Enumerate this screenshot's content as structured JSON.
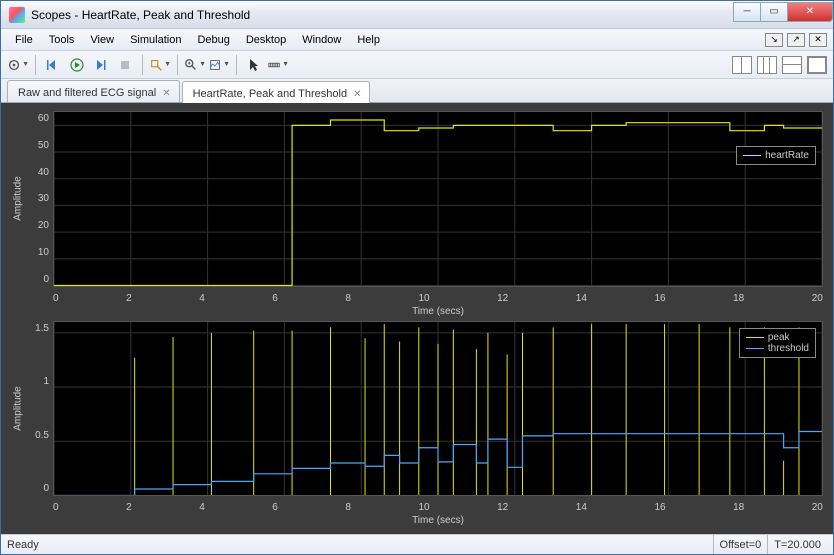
{
  "window": {
    "title": "Scopes - HeartRate, Peak and Threshold"
  },
  "menu": {
    "file": "File",
    "tools": "Tools",
    "view": "View",
    "simulation": "Simulation",
    "debug": "Debug",
    "desktop": "Desktop",
    "window": "Window",
    "help": "Help"
  },
  "tabs": [
    {
      "label": "Raw and filtered ECG signal",
      "active": false
    },
    {
      "label": "HeartRate, Peak and Threshold",
      "active": true
    }
  ],
  "status": {
    "ready": "Ready",
    "offset": "Offset=0",
    "time": "T=20.000"
  },
  "axis": {
    "ylabel": "Amplitude",
    "xlabel": "Time (secs)"
  },
  "legend1": {
    "heartRate": "heartRate"
  },
  "legend2": {
    "peak": "peak",
    "threshold": "threshold"
  },
  "chart_data": [
    {
      "type": "line",
      "title": "",
      "xlabel": "Time (secs)",
      "ylabel": "Amplitude",
      "xlim": [
        0,
        20
      ],
      "ylim": [
        0,
        65
      ],
      "xticks": [
        0,
        2,
        4,
        6,
        8,
        10,
        12,
        14,
        16,
        18,
        20
      ],
      "yticks": [
        0,
        10,
        20,
        30,
        40,
        50,
        60
      ],
      "series": [
        {
          "name": "heartRate",
          "color": "#e6e600",
          "x": [
            0,
            6.2,
            6.2,
            7.2,
            7.2,
            8.6,
            8.6,
            9.5,
            9.5,
            10.4,
            10.4,
            13.0,
            13.0,
            14.0,
            14.0,
            14.9,
            14.9,
            17.6,
            17.6,
            18.5,
            18.5,
            19.0,
            19.0,
            20.0
          ],
          "y": [
            0,
            0,
            60,
            60,
            62,
            62,
            58,
            58,
            59,
            59,
            60,
            60,
            58,
            58,
            60,
            60,
            61,
            61,
            58,
            58,
            60,
            60,
            59,
            59
          ]
        }
      ]
    },
    {
      "type": "line",
      "title": "",
      "xlabel": "Time (secs)",
      "ylabel": "Amplitude",
      "xlim": [
        0,
        20
      ],
      "ylim": [
        0,
        1.6
      ],
      "xticks": [
        0,
        2,
        4,
        6,
        8,
        10,
        12,
        14,
        16,
        18,
        20
      ],
      "yticks": [
        0,
        0.5,
        1,
        1.5
      ],
      "series": [
        {
          "name": "peak",
          "color": "#e6e600",
          "spikes_x": [
            2.1,
            3.1,
            4.1,
            5.2,
            6.2,
            7.2,
            8.1,
            8.6,
            9.0,
            9.5,
            10.0,
            10.4,
            11.0,
            11.3,
            11.8,
            12.2,
            13.0,
            14.0,
            14.9,
            15.9,
            16.8,
            17.6,
            18.5,
            19.0,
            19.4
          ],
          "spikes_y": [
            1.27,
            1.46,
            1.5,
            1.52,
            1.52,
            1.55,
            1.45,
            1.58,
            1.42,
            1.55,
            1.4,
            1.53,
            1.35,
            1.5,
            1.3,
            1.5,
            1.55,
            1.58,
            1.58,
            1.58,
            1.58,
            1.55,
            1.55,
            0.32,
            1.55
          ]
        },
        {
          "name": "threshold",
          "color": "#4aa8ff",
          "x": [
            0,
            2.1,
            2.1,
            3.1,
            3.1,
            4.1,
            4.1,
            5.2,
            5.2,
            6.2,
            6.2,
            7.2,
            7.2,
            8.1,
            8.1,
            8.6,
            8.6,
            9.0,
            9.0,
            9.5,
            9.5,
            10.0,
            10.0,
            10.4,
            10.4,
            11.0,
            11.0,
            11.3,
            11.3,
            11.8,
            11.8,
            12.2,
            12.2,
            13.0,
            13.0,
            19.0,
            19.0,
            19.4,
            19.4,
            20.0
          ],
          "y": [
            0,
            0,
            0.06,
            0.06,
            0.1,
            0.1,
            0.13,
            0.13,
            0.2,
            0.2,
            0.25,
            0.25,
            0.3,
            0.3,
            0.27,
            0.27,
            0.37,
            0.37,
            0.3,
            0.3,
            0.44,
            0.44,
            0.31,
            0.31,
            0.47,
            0.47,
            0.3,
            0.3,
            0.52,
            0.52,
            0.26,
            0.26,
            0.55,
            0.55,
            0.57,
            0.57,
            0.44,
            0.44,
            0.59,
            0.59
          ]
        }
      ]
    }
  ]
}
